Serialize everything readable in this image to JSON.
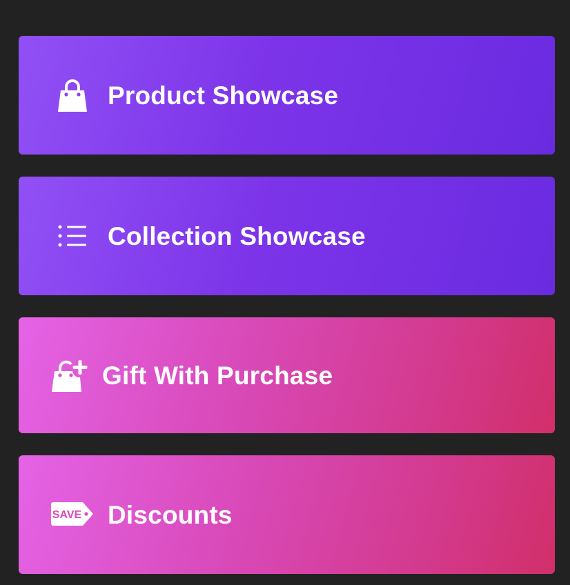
{
  "menu": {
    "items": [
      {
        "label": "Product Showcase",
        "icon": "shopping-bag-icon",
        "theme": "purple"
      },
      {
        "label": "Collection Showcase",
        "icon": "list-icon",
        "theme": "purple"
      },
      {
        "label": "Gift With Purchase",
        "icon": "bag-plus-icon",
        "theme": "pink"
      },
      {
        "label": "Discounts",
        "icon": "save-tag-icon",
        "theme": "pink"
      }
    ],
    "save_tag_text": "SAVE"
  },
  "colors": {
    "background": "#222222",
    "purple_start": "#9150f5",
    "purple_end": "#6a2be0",
    "pink_start": "#e463e6",
    "pink_end": "#d22f6a",
    "text": "#ffffff"
  }
}
